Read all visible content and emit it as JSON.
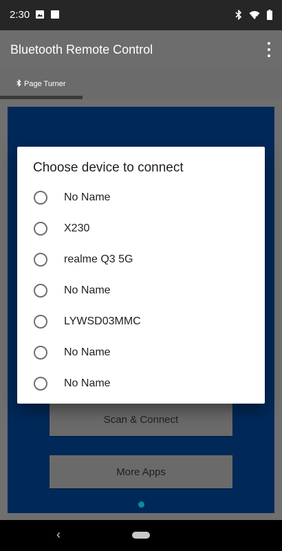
{
  "status_bar": {
    "time": "2:30",
    "icons": [
      "image-icon",
      "square-notification-icon",
      "bluetooth-icon",
      "wifi-icon",
      "battery-icon"
    ]
  },
  "app_bar": {
    "title": "Bluetooth Remote Control",
    "menu_icon": "more-vert-icon"
  },
  "tabs": [
    {
      "label": "Page Turner",
      "icon": "bluetooth-icon",
      "selected": true
    }
  ],
  "main": {
    "buttons": {
      "scan_connect": "Scan & Connect",
      "more_apps": "More Apps"
    },
    "page_indicator": {
      "count": 1,
      "active": 0
    }
  },
  "dialog": {
    "title": "Choose device to connect",
    "devices": [
      {
        "label": "No Name"
      },
      {
        "label": "X230"
      },
      {
        "label": "realme Q3 5G"
      },
      {
        "label": "No Name"
      },
      {
        "label": "LYWSD03MMC"
      },
      {
        "label": "No Name"
      },
      {
        "label": "No Name"
      }
    ]
  },
  "nav_bar": {
    "icons": [
      "back-icon",
      "home-pill-icon"
    ]
  },
  "colors": {
    "status_bar": "#262626",
    "app_bar": "#6d6d6d",
    "panel": "#00295a",
    "page_dot": "#0d8a9a",
    "dialog_bg": "#ffffff"
  }
}
